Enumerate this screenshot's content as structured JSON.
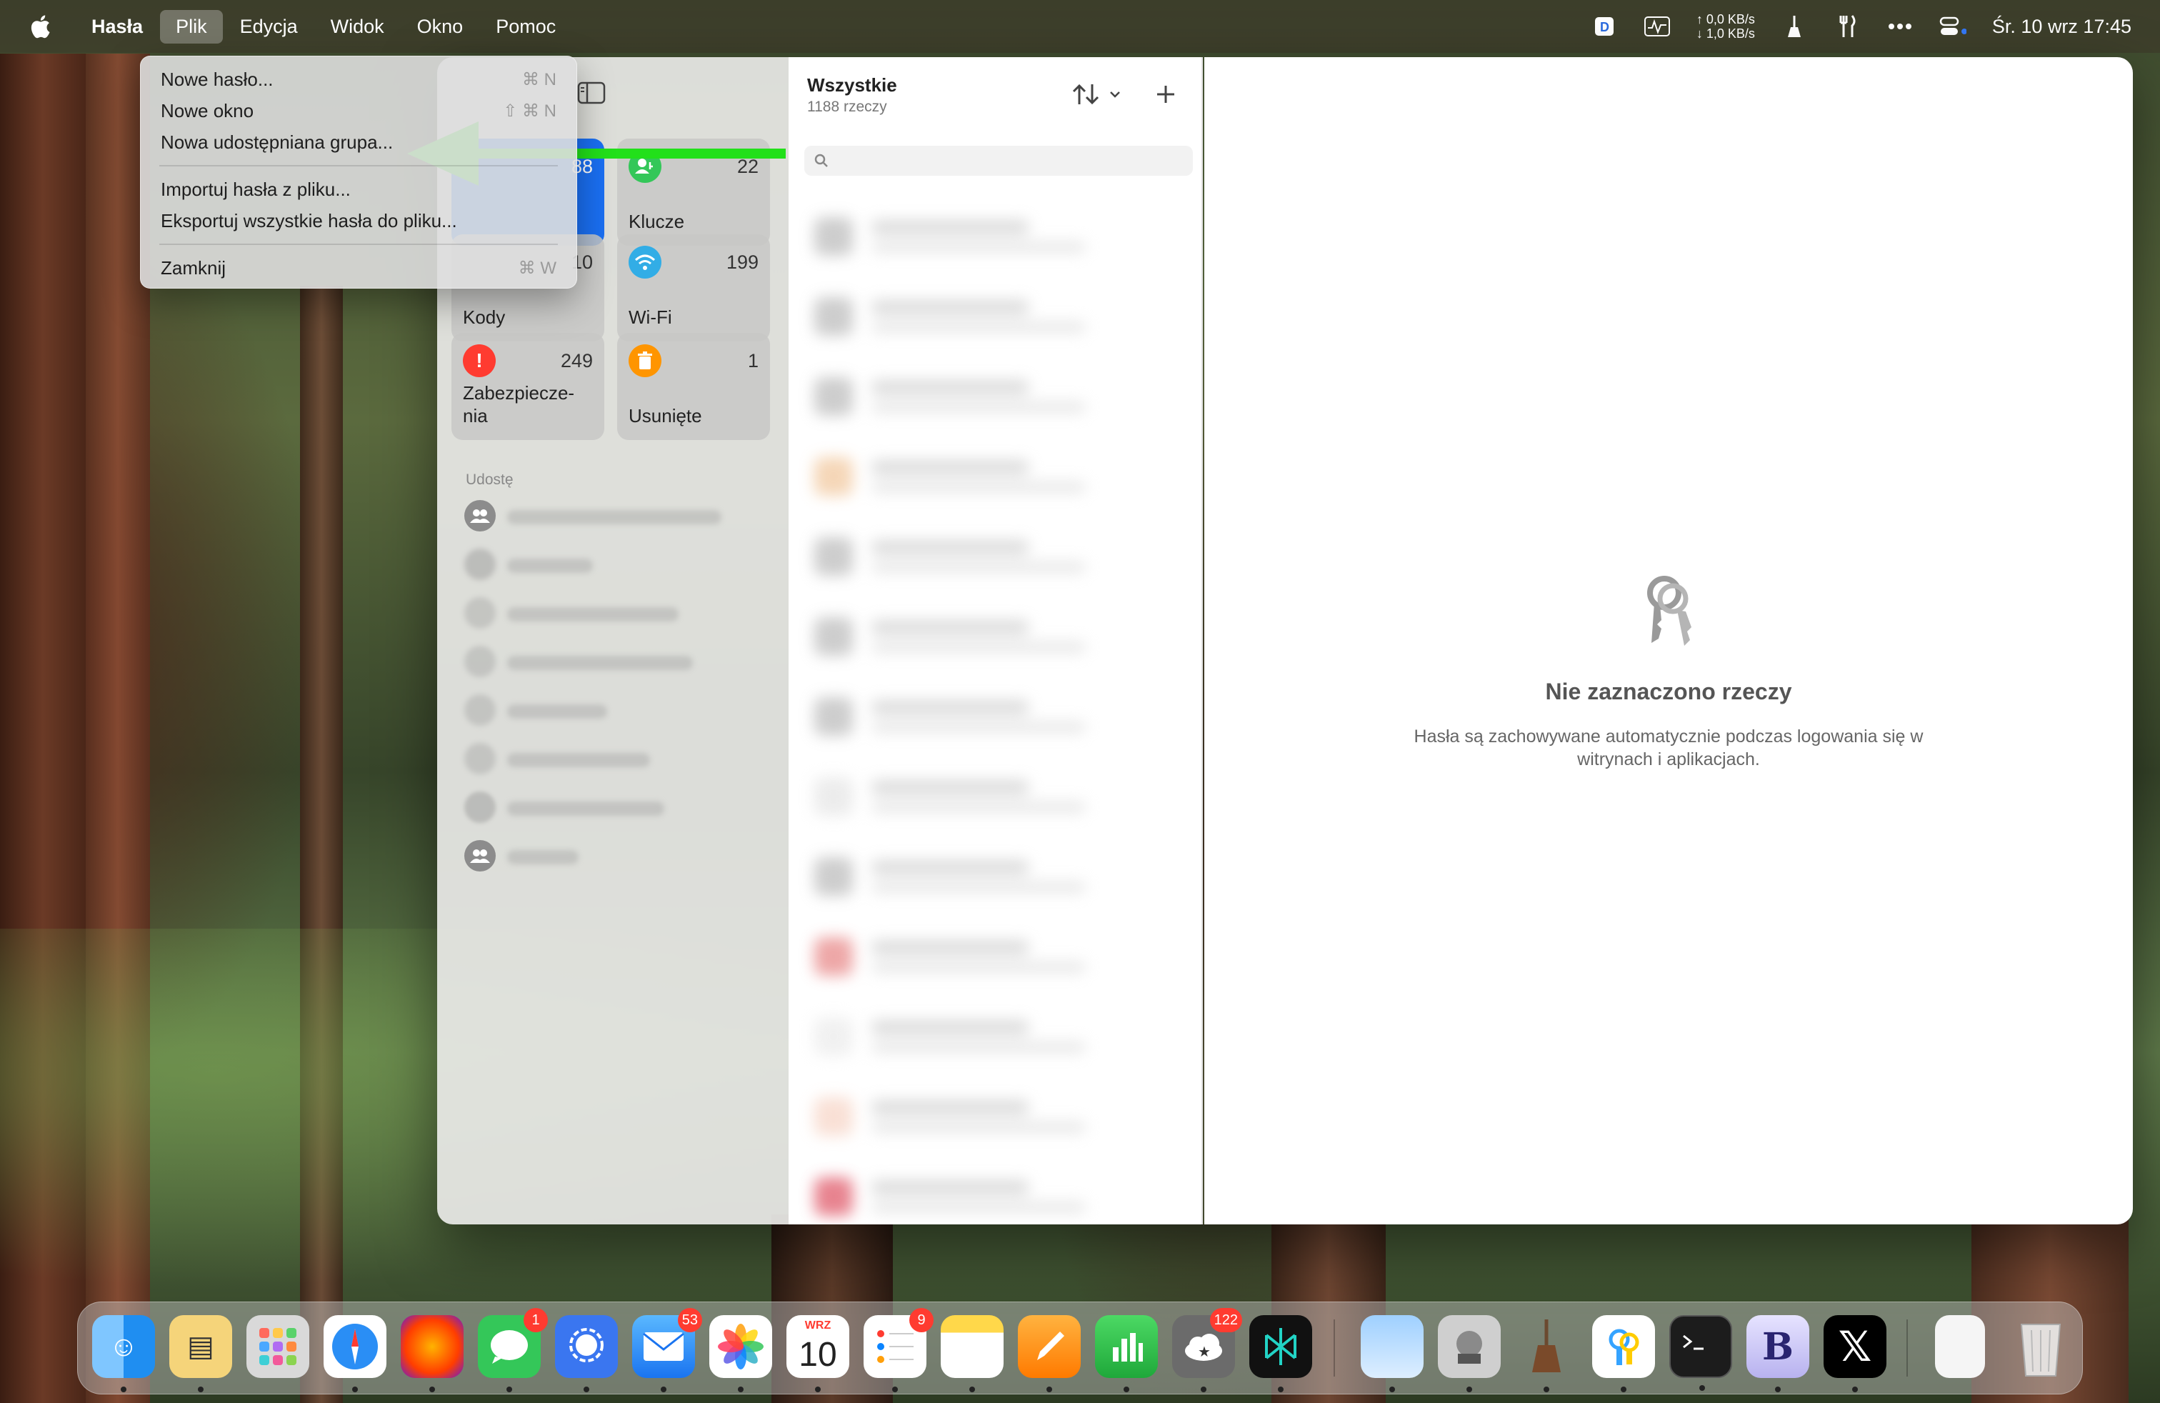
{
  "menubar": {
    "app_name": "Hasła",
    "items": [
      "Plik",
      "Edycja",
      "Widok",
      "Okno",
      "Pomoc"
    ],
    "net_up": "↑ 0,0 KB/s",
    "net_down": "↓ 1,0 KB/s",
    "datetime": "Śr. 10 wrz  17:45"
  },
  "file_menu": {
    "items": [
      {
        "label": "Nowe hasło...",
        "shortcut": "⌘ N"
      },
      {
        "label": "Nowe okno",
        "shortcut": "⇧ ⌘ N"
      },
      {
        "label": "Nowa udostępniana grupa...",
        "shortcut": ""
      },
      {
        "label": "Importuj hasła z pliku...",
        "shortcut": ""
      },
      {
        "label": "Eksportuj wszystkie hasła do pliku...",
        "shortcut": ""
      },
      {
        "label": "Zamknij",
        "shortcut": "⌘ W"
      }
    ]
  },
  "sidebar": {
    "tiles": [
      {
        "label": "",
        "count": "88",
        "color": "#1a6ff2"
      },
      {
        "label": "Klucze",
        "count": "22",
        "color": "#34c759"
      },
      {
        "label": "Kody",
        "count": "10",
        "color": "#8e8e93"
      },
      {
        "label": "Wi-Fi",
        "count": "199",
        "color": "#32ade6"
      },
      {
        "label": "Zabezpiecze-nia",
        "count": "249",
        "color": "#ff3b30"
      },
      {
        "label": "Usunięte",
        "count": "1",
        "color": "#ff9500"
      }
    ],
    "section_label": "Udostę"
  },
  "list": {
    "title": "Wszystkie",
    "subtitle": "1188 rzeczy"
  },
  "detail": {
    "empty_title": "Nie zaznaczono rzeczy",
    "empty_text": "Hasła są zachowywane automatycznie podczas logowania się w witrynach i aplikacjach."
  },
  "dock": {
    "calendar_month": "WRZ",
    "calendar_day": "10",
    "badges": {
      "messages": "1",
      "mail": "53",
      "reminders": "9",
      "weather": "122"
    }
  },
  "colors": {
    "accent": "#1a6ff2",
    "arrow": "#22e01a"
  }
}
